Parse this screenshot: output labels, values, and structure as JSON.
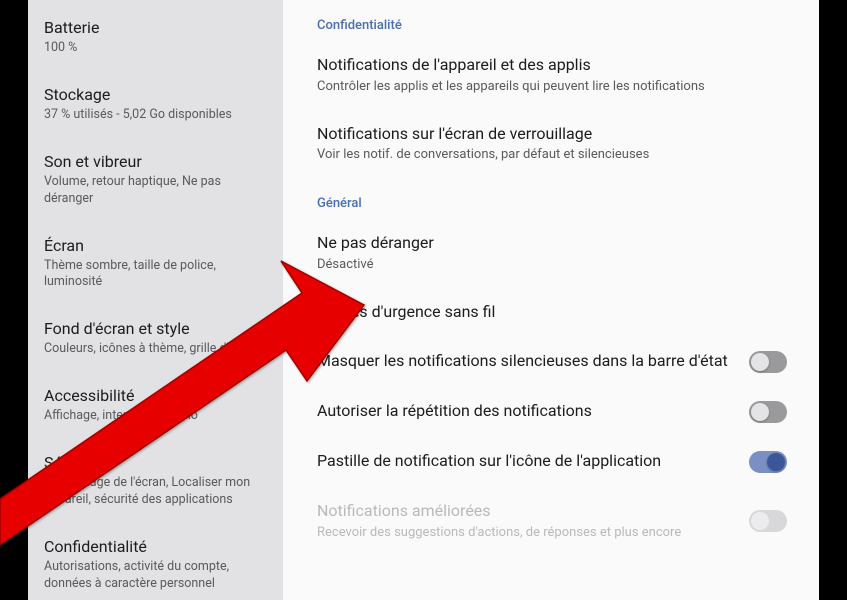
{
  "sidebar": {
    "items": [
      {
        "title": "Batterie",
        "subtitle": "100 %"
      },
      {
        "title": "Stockage",
        "subtitle": "37 % utilisés - 5,02 Go disponibles"
      },
      {
        "title": "Son et vibreur",
        "subtitle": "Volume, retour haptique, Ne pas déranger"
      },
      {
        "title": "Écran",
        "subtitle": "Thème sombre, taille de police, luminosité"
      },
      {
        "title": "Fond d'écran et style",
        "subtitle": "Couleurs, icônes à thème, grille d'applis"
      },
      {
        "title": "Accessibilité",
        "subtitle": "Affichage, interaction, audio"
      },
      {
        "title": "Sécurité",
        "subtitle": "Verrouillage de l'écran, Localiser mon appareil, sécurité des applications"
      },
      {
        "title": "Confidentialité",
        "subtitle": "Autorisations, activité du compte, données à caractère personnel"
      }
    ]
  },
  "main": {
    "sections": {
      "privacy": {
        "header": "Confidentialité",
        "rows": [
          {
            "title": "Notifications de l'appareil et des applis",
            "subtitle": "Contrôler les applis et les appareils qui peuvent lire les notifications"
          },
          {
            "title": "Notifications sur l'écran de verrouillage",
            "subtitle": "Voir les notif. de conversations, par défaut et silencieuses"
          }
        ]
      },
      "general": {
        "header": "Général",
        "rows": {
          "dnd": {
            "title": "Ne pas déranger",
            "subtitle": "Désactivé"
          },
          "wea": {
            "title": "Alertes d'urgence sans fil"
          },
          "hide_silent": {
            "title": "Masquer les notifications silencieuses dans la barre d'état",
            "toggle": "off"
          },
          "allow_repeat": {
            "title": "Autoriser la répétition des notifications",
            "toggle": "off"
          },
          "badge": {
            "title": "Pastille de notification sur l'icône de l'application",
            "toggle": "on"
          },
          "enhanced": {
            "title": "Notifications améliorées",
            "subtitle": "Recevoir des suggestions d'actions, de réponses et plus encore",
            "toggle": "disabled"
          }
        }
      }
    }
  }
}
